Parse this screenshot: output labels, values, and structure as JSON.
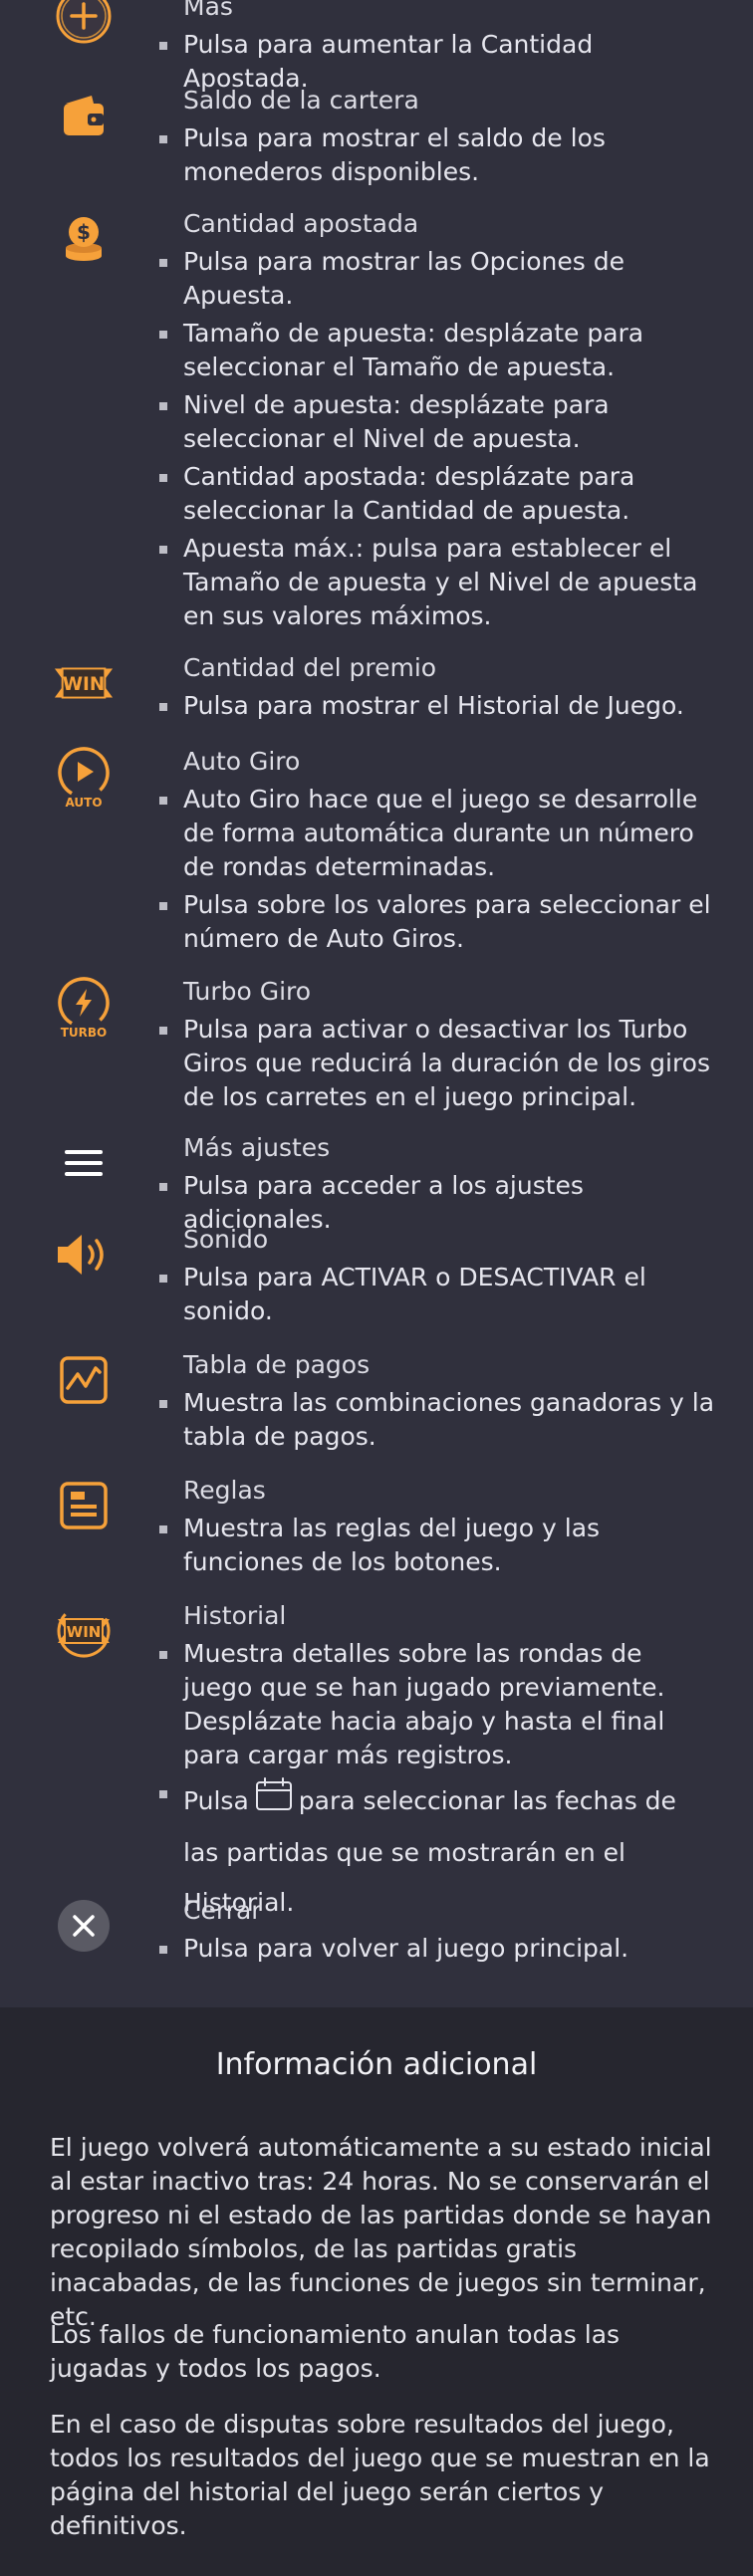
{
  "colors": {
    "accent": "#f6a13a",
    "background": "#30303d",
    "info_background": "#26262f"
  },
  "items": [
    {
      "icon": "plus-circle-icon",
      "title": "Más",
      "bullets": [
        "Pulsa para aumentar la Cantidad Apostada."
      ]
    },
    {
      "icon": "wallet-icon",
      "title": "Saldo de la cartera",
      "bullets": [
        "Pulsa para mostrar el saldo de los monederos disponibles."
      ]
    },
    {
      "icon": "coins-icon",
      "title": "Cantidad apostada",
      "bullets": [
        "Pulsa para mostrar las Opciones de Apuesta.",
        "Tamaño de apuesta: desplázate para seleccionar el Tamaño de apuesta.",
        "Nivel de apuesta: desplázate para seleccionar el Nivel de apuesta.",
        "Cantidad apostada: desplázate para seleccionar la Cantidad de apuesta.",
        "Apuesta máx.: pulsa para establecer el Tamaño de apuesta y el Nivel de apuesta en sus valores máximos."
      ]
    },
    {
      "icon": "win-icon",
      "title": "Cantidad del premio",
      "bullets": [
        "Pulsa para mostrar el Historial de Juego."
      ]
    },
    {
      "icon": "auto-play-icon",
      "title": "Auto Giro",
      "icon_text": "AUTO",
      "bullets": [
        "Auto Giro hace que el juego se desarrolle de forma automática durante un número de rondas determinadas.",
        "Pulsa sobre los valores para seleccionar el número de Auto Giros."
      ]
    },
    {
      "icon": "turbo-icon",
      "title": "Turbo Giro",
      "icon_text": "TURBO",
      "bullets": [
        "Pulsa para activar o desactivar los Turbo Giros que reducirá la duración de los giros de los carretes en el juego principal."
      ]
    },
    {
      "icon": "menu-icon",
      "title": "Más ajustes",
      "bullets": [
        "Pulsa para acceder a los ajustes adicionales."
      ]
    },
    {
      "icon": "speaker-icon",
      "title": "Sonido",
      "bullets": [
        "Pulsa para ACTIVAR o DESACTIVAR el sonido."
      ]
    },
    {
      "icon": "paytable-icon",
      "title": "Tabla de pagos",
      "bullets": [
        "Muestra las combinaciones ganadoras y la tabla de pagos."
      ]
    },
    {
      "icon": "rules-icon",
      "title": "Reglas",
      "bullets": [
        "Muestra las reglas del juego y las funciones de los botones."
      ]
    },
    {
      "icon": "history-icon",
      "title": "Historial",
      "bullets": [
        "Muestra detalles sobre las rondas de juego que se han jugado previamente. Desplázate hacia abajo y hasta el final para cargar más registros."
      ],
      "calendar_bullet": {
        "before": "Pulsa",
        "after": "para seleccionar las fechas de las partidas que se mostrarán en el Historial."
      }
    },
    {
      "icon": "close-icon",
      "title": "Cerrar",
      "bullets": [
        "Pulsa para volver al juego principal."
      ]
    }
  ],
  "win_label": "WIN",
  "additional_info": {
    "title": "Información adicional",
    "paragraphs": [
      "El juego volverá automáticamente a su estado inicial al estar inactivo tras: 24 horas. No se conservarán el progreso ni el estado de las partidas donde se hayan recopilado símbolos, de las partidas gratis inacabadas, de las funciones de juegos sin terminar, etc.",
      "Los fallos de funcionamiento anulan todas las jugadas y todos los pagos.",
      "En el caso de disputas sobre resultados del juego, todos los resultados del juego que se muestran en la página del historial del juego serán ciertos y definitivos."
    ]
  }
}
